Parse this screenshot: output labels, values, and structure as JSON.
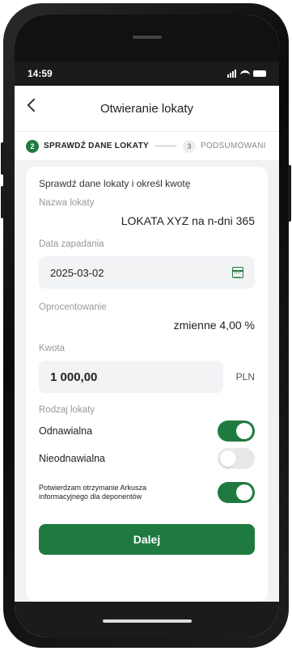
{
  "status": {
    "time": "14:59"
  },
  "header": {
    "title": "Otwieranie lokaty"
  },
  "steps": [
    {
      "number": "2",
      "label": "SPRAWDŹ DANE LOKATY",
      "active": true
    },
    {
      "number": "3",
      "label": "PODSUMOWANI",
      "active": false
    }
  ],
  "form": {
    "intro": "Sprawdź dane lokaty i określ kwotę",
    "name_label": "Nazwa lokaty",
    "name_value": "LOKATA XYZ na n-dni 365",
    "date_label": "Data zapadania",
    "date_value": "2025-03-02",
    "rate_label": "Oprocentowanie",
    "rate_value": "zmienne 4,00 %",
    "amount_label": "Kwota",
    "amount_value": "1 000,00",
    "currency": "PLN",
    "type_label": "Rodzaj lokaty",
    "renewable_label": "Odnawialna",
    "renewable_on": true,
    "nonrenewable_label": "Nieodnawialna",
    "nonrenewable_on": false,
    "confirm_label": "Potwierdzam otrzymanie Arkusza informacyjnego dla deponentów",
    "confirm_on": true,
    "submit_label": "Dalej"
  },
  "colors": {
    "accent": "#1f7a3f",
    "background": "#f1f2f4"
  }
}
